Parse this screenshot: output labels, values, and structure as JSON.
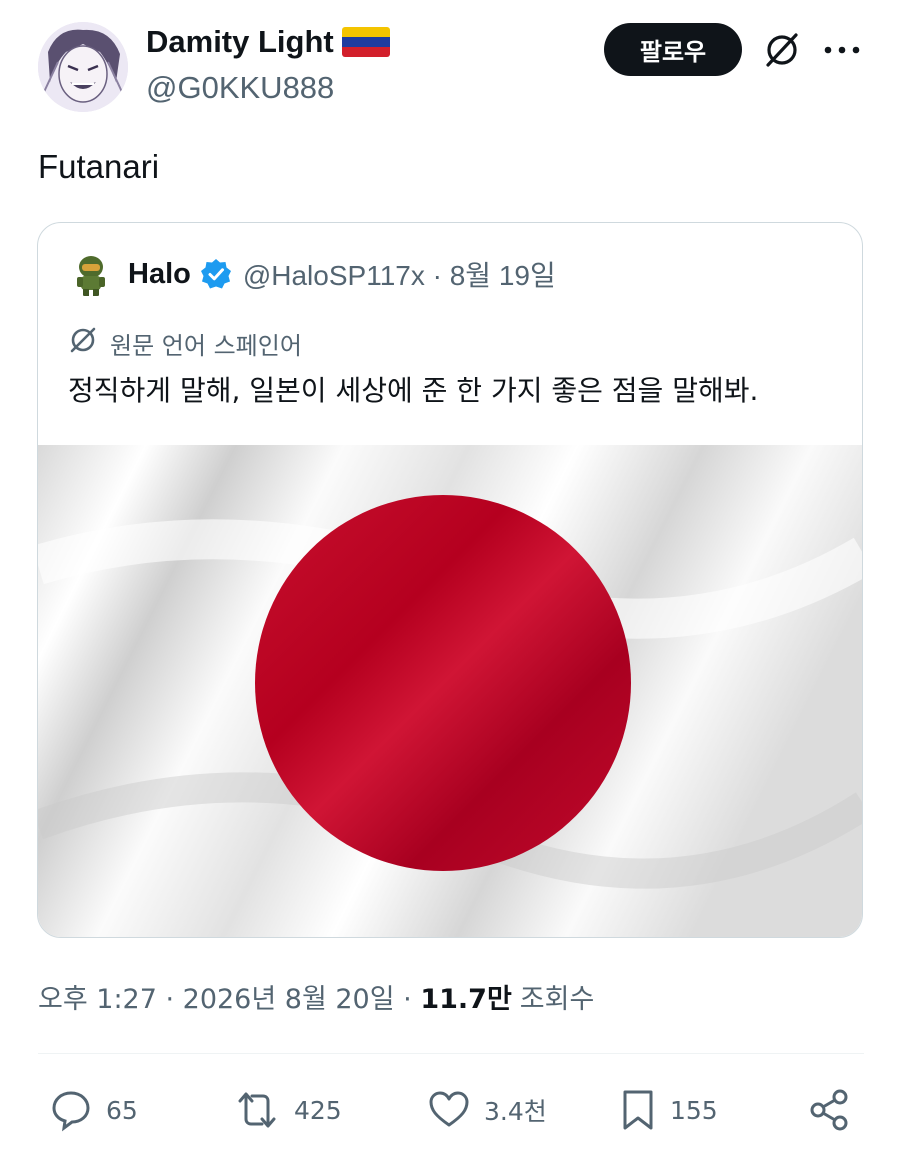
{
  "author": {
    "display_name": "Damity Light",
    "handle": "@G0KKU888",
    "flag_emoji": "venezuela-flag",
    "avatar": "anime-avatar"
  },
  "header": {
    "follow_label": "팔로우",
    "translate_icon": "translate-icon",
    "more_icon": "more-icon"
  },
  "tweet": {
    "text": "Futanari"
  },
  "quote": {
    "name": "Halo",
    "handle_date": "@HaloSP117x · 8월 19일",
    "verified_icon": "verified-badge-icon",
    "language_note": "원문 언어 스페인어",
    "text": "정직하게 말해, 일본이 세상에 준 한 가지 좋은 점을 말해봐.",
    "media": "japan-flag-image"
  },
  "meta": {
    "time_date": "오후 1:27 · 2026년 8월 20일 · ",
    "views_count": "11.7만",
    "views_label": "조회수"
  },
  "actions": {
    "replies": "65",
    "reposts": "425",
    "likes": "3.4천",
    "bookmarks": "155"
  },
  "colors": {
    "text_primary": "#0f1419",
    "text_secondary": "#536471",
    "verified": "#1d9bf0",
    "border": "#cfd9de",
    "flag_red": "#bc002d"
  }
}
